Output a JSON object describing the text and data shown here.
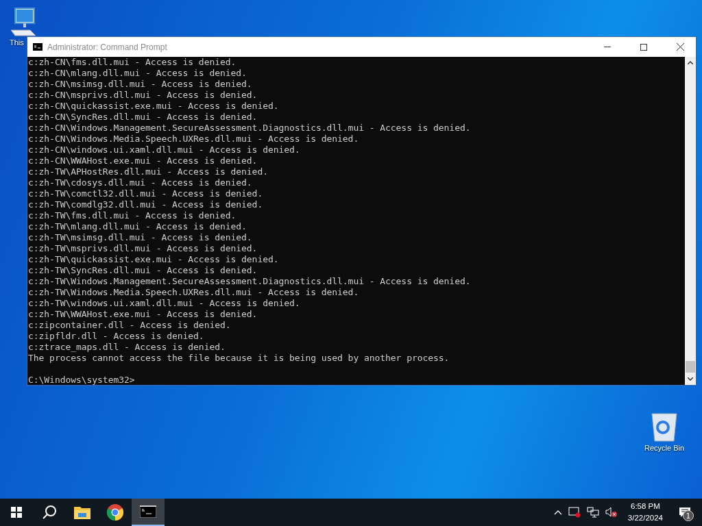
{
  "desktop_icons": [
    {
      "kind": "computer",
      "label": "This"
    },
    {
      "kind": "recycle",
      "label": "Recycle Bin"
    }
  ],
  "window": {
    "title": "Administrator: Command Prompt",
    "lines": [
      "c:zh-CN\\fms.dll.mui - Access is denied.",
      "c:zh-CN\\mlang.dll.mui - Access is denied.",
      "c:zh-CN\\msimsg.dll.mui - Access is denied.",
      "c:zh-CN\\msprivs.dll.mui - Access is denied.",
      "c:zh-CN\\quickassist.exe.mui - Access is denied.",
      "c:zh-CN\\SyncRes.dll.mui - Access is denied.",
      "c:zh-CN\\Windows.Management.SecureAssessment.Diagnostics.dll.mui - Access is denied.",
      "c:zh-CN\\Windows.Media.Speech.UXRes.dll.mui - Access is denied.",
      "c:zh-CN\\windows.ui.xaml.dll.mui - Access is denied.",
      "c:zh-CN\\WWAHost.exe.mui - Access is denied.",
      "c:zh-TW\\APHostRes.dll.mui - Access is denied.",
      "c:zh-TW\\cdosys.dll.mui - Access is denied.",
      "c:zh-TW\\comctl32.dll.mui - Access is denied.",
      "c:zh-TW\\comdlg32.dll.mui - Access is denied.",
      "c:zh-TW\\fms.dll.mui - Access is denied.",
      "c:zh-TW\\mlang.dll.mui - Access is denied.",
      "c:zh-TW\\msimsg.dll.mui - Access is denied.",
      "c:zh-TW\\msprivs.dll.mui - Access is denied.",
      "c:zh-TW\\quickassist.exe.mui - Access is denied.",
      "c:zh-TW\\SyncRes.dll.mui - Access is denied.",
      "c:zh-TW\\Windows.Management.SecureAssessment.Diagnostics.dll.mui - Access is denied.",
      "c:zh-TW\\Windows.Media.Speech.UXRes.dll.mui - Access is denied.",
      "c:zh-TW\\windows.ui.xaml.dll.mui - Access is denied.",
      "c:zh-TW\\WWAHost.exe.mui - Access is denied.",
      "c:zipcontainer.dll - Access is denied.",
      "c:zipfldr.dll - Access is denied.",
      "c:ztrace_maps.dll - Access is denied.",
      "The process cannot access the file because it is being used by another process."
    ],
    "prompt": "C:\\Windows\\system32>"
  },
  "taskbar": {
    "apps": [
      {
        "kind": "start",
        "selected": false
      },
      {
        "kind": "search",
        "selected": false
      },
      {
        "kind": "explorer",
        "selected": false
      },
      {
        "kind": "chrome",
        "selected": false
      },
      {
        "kind": "cmd",
        "selected": true
      }
    ],
    "clock": {
      "time": "6:58 PM",
      "date": "3/22/2024"
    },
    "notifications": "1"
  }
}
